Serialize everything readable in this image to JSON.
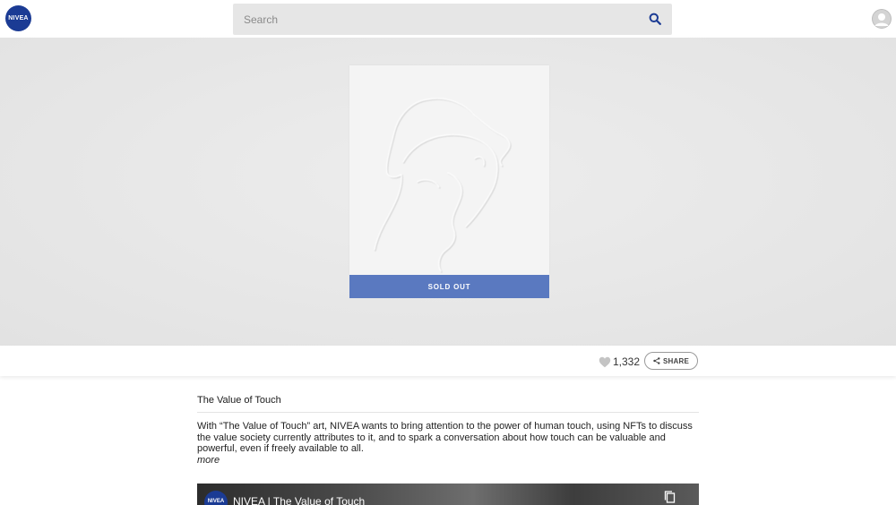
{
  "header": {
    "logo_text": "NIVEA",
    "search_placeholder": "Search",
    "search_icon": "search-icon",
    "avatar_icon": "user-avatar-icon"
  },
  "artwork": {
    "status_label": "SOLD OUT"
  },
  "actions": {
    "likes_count": "1,332",
    "share_label": "SHARE"
  },
  "details": {
    "title": "The Value of Touch",
    "description": "With “The Value of Touch” art, NIVEA wants to bring attention to the power of human touch, using NFTs to discuss the value society currently attributes to it, and to spark a conversation about how touch can be valuable and powerful, even if freely available to all.",
    "more_label": "more"
  },
  "video": {
    "channel_logo_text": "NIVEA",
    "title": "NIVEA | The Value of Touch"
  },
  "colors": {
    "brand_blue": "#1b3b94",
    "sold_out_bar": "#5a79c0"
  }
}
